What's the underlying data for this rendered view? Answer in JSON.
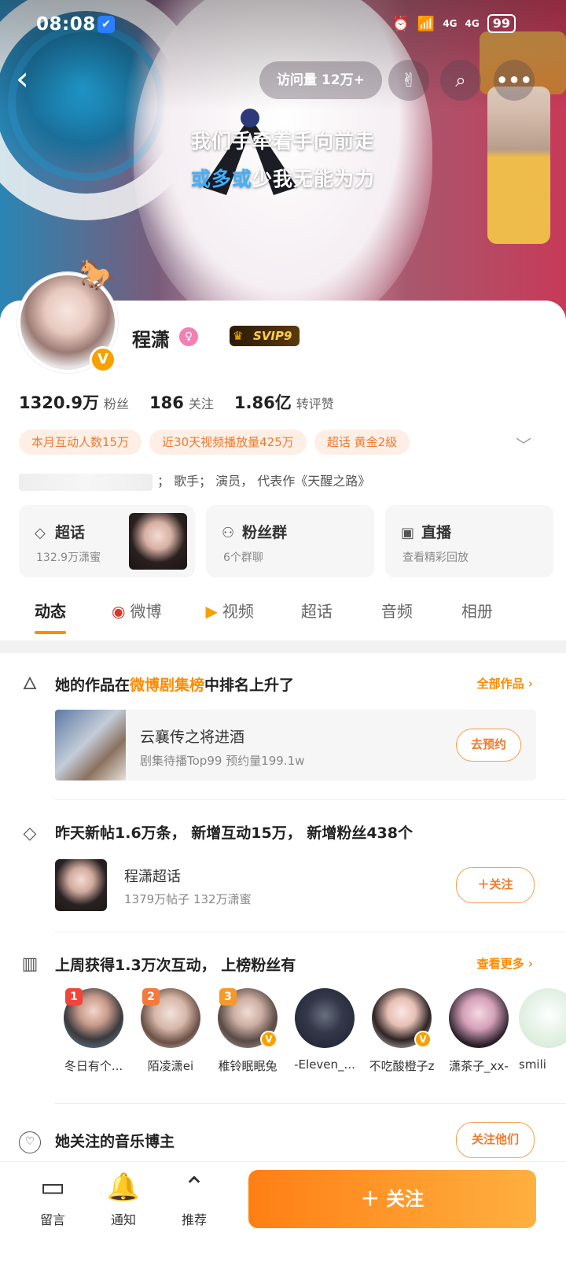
{
  "status_bar": {
    "time": "08:08",
    "battery": "99",
    "network1": "4G",
    "network2": "4G"
  },
  "top_nav": {
    "visits_label": "访问量",
    "visits_value": "12万+"
  },
  "lyrics": {
    "line1": "我们手牵着手向前走",
    "line2_highlight": "或多或",
    "line2_rest": "少我无能为力"
  },
  "profile": {
    "name": "程潇",
    "svip": "SVIP9",
    "stats": [
      {
        "num": "1320.9万",
        "label": "粉丝"
      },
      {
        "num": "186",
        "label": "关注"
      },
      {
        "num": "1.86亿",
        "label": "转评赞"
      }
    ],
    "tags": [
      "本月互动人数15万",
      "近30天视频播放量425万",
      "超话  黄金2级"
    ],
    "bio": "；  歌手；  演员，  代表作《天醒之路》"
  },
  "features": [
    {
      "title": "超话",
      "sub": "132.9万潇蜜"
    },
    {
      "title": "粉丝群",
      "sub": "6个群聊"
    },
    {
      "title": "直播",
      "sub": "查看精彩回放"
    }
  ],
  "tabs": [
    "动态",
    "微博",
    "视频",
    "超话",
    "音频",
    "相册"
  ],
  "sections": {
    "rank": {
      "title_pre": "她的作品在",
      "title_hl": "微博剧集榜",
      "title_post": "中排名上升了",
      "more": "全部作品",
      "work_title": "云襄传之将进酒",
      "work_sub": "剧集待播Top99  预约量199.1w",
      "button": "去预约"
    },
    "topic": {
      "title": "昨天新帖1.6万条，  新增互动15万，  新增粉丝438个",
      "topic_title": "程潇超话",
      "topic_sub": "1379万帖子  132万潇蜜",
      "button": "关注"
    },
    "fans": {
      "title": "上周获得1.3万次互动，  上榜粉丝有",
      "more": "查看更多",
      "list": [
        {
          "rank": "1",
          "name": "冬日有个..."
        },
        {
          "rank": "2",
          "name": "陌凌潇ei"
        },
        {
          "rank": "3",
          "name": "稚铃眠眠兔"
        },
        {
          "rank": "",
          "name": "-Eleven_..."
        },
        {
          "rank": "",
          "name": "不吃酸橙子z"
        },
        {
          "rank": "",
          "name": "潇茶子_xx-"
        },
        {
          "rank": "",
          "name": "smili"
        }
      ]
    },
    "music": {
      "title": "她关注的音乐博主",
      "button": "关注他们"
    }
  },
  "bottom_bar": {
    "items": [
      {
        "label": "留言",
        "icon": "message-icon"
      },
      {
        "label": "通知",
        "icon": "bell-add-icon"
      },
      {
        "label": "推荐",
        "icon": "chevron-up-circle-icon"
      }
    ],
    "follow": "关注"
  },
  "colors": {
    "accent": "#ff8a00",
    "tag_bg": "#fdefe6",
    "tag_text": "#f07a2d"
  }
}
